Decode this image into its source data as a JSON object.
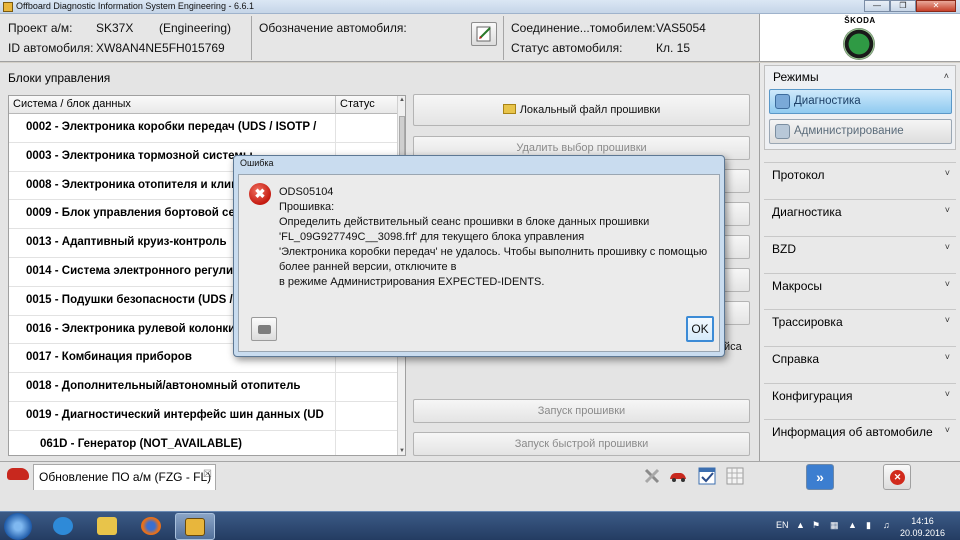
{
  "window": {
    "title": "Offboard Diagnostic Information System Engineering - 6.6.1",
    "controls": [
      "minimize",
      "maximize",
      "close"
    ]
  },
  "header": {
    "project_label": "Проект а/м:",
    "project_value": "SK37X",
    "project_mode": "(Engineering)",
    "vin_label": "ID автомобиля:",
    "vin_value": "XW8AN4NE5FH015769",
    "designation_label": "Обозначение автомобиля:",
    "connection_label": "Соединение...томобилем:",
    "connection_value": "VAS5054",
    "status_label": "Статус автомобиля:",
    "status_value": "Кл. 15",
    "brand": "ŠKODA"
  },
  "blocks": {
    "title": "Блоки управления",
    "col_system": "Система / блок данных",
    "col_status": "Статус",
    "rows": [
      {
        "text": "0002 - Электроника коробки передач  (UDS / ISOTP / ",
        "indent": false
      },
      {
        "text": "0003 - Электроника тормозной системы",
        "indent": false
      },
      {
        "text": "0008 - Электроника отопителя и климатической установки",
        "indent": false
      },
      {
        "text": "0009 - Блок управления бортовой сети",
        "indent": false
      },
      {
        "text": "0013 - Адаптивный круиз-контроль",
        "indent": false
      },
      {
        "text": "0014 - Система электронного регулирования",
        "indent": false
      },
      {
        "text": "0015 - Подушки безопасности  (UDS / ISOTP",
        "indent": false
      },
      {
        "text": "0016 - Электроника рулевой колонки",
        "indent": false
      },
      {
        "text": "0017 - Комбинация приборов",
        "indent": false
      },
      {
        "text": "0018 - Дополнительный/автономный отопитель",
        "indent": false
      },
      {
        "text": "0019 - Диагностический интерфейс шин данных  (UD",
        "indent": false
      },
      {
        "text": "061D - Генератор (NOT_AVAILABLE)",
        "indent": true
      }
    ]
  },
  "actions": {
    "local_file": "Локальный файл прошивки",
    "remove_selection": "Удалить выбор прошивки",
    "partial_text": "йса",
    "start_flash": "Запуск прошивки",
    "start_fast_flash": "Запуск быстрой прошивки"
  },
  "sidebar": {
    "modes_title": "Режимы",
    "modes": [
      {
        "label": "Диагностика",
        "selected": true
      },
      {
        "label": "Администрирование",
        "selected": false
      }
    ],
    "sections": [
      "Протокол",
      "Диагностика",
      "BZD",
      "Макросы",
      "Трассировка",
      "Справка",
      "Конфигурация",
      "Информация об автомобиле"
    ]
  },
  "bottom": {
    "tab_label": "Обновление ПО а/м (FZG - FL)",
    "tab_close": "☒"
  },
  "dialog": {
    "title": "Ошибка",
    "lines": [
      "ODS05104",
      "Прошивка:",
      "Определить действительный сеанс прошивки в блоке данных прошивки",
      "'FL_09G927749C__3098.frf' для текущего блока управления",
      "'Электроника коробки передач' не удалось. Чтобы выполнить прошивку с помощью",
      "более ранней версии, отключите в",
      "в режиме Администрирования EXPECTED-IDENTS."
    ],
    "ok": "OK"
  },
  "taskbar": {
    "lang": "EN",
    "time": "14:16",
    "date": "20.09.2016"
  },
  "colors": {
    "accent": "#8fcaf0",
    "error": "#c41a10",
    "taskbar": "#243c62"
  }
}
